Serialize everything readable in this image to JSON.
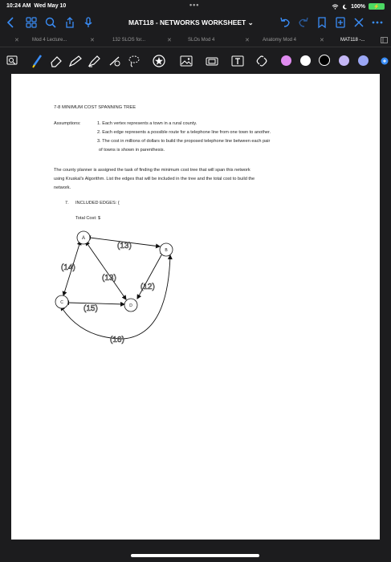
{
  "status": {
    "time": "10:24 AM",
    "date": "Wed May 10",
    "dots": "•••",
    "battery": "100%"
  },
  "nav": {
    "title": "MAT118 - NETWORKS WORKSHEET ⌄"
  },
  "tabs": [
    {
      "label": "Mod 4 Lecture..."
    },
    {
      "label": "132 SLOS for..."
    },
    {
      "label": "SLOs Mod 4"
    },
    {
      "label": "Anatomy Mod 4"
    },
    {
      "label": "MAT118 -..."
    }
  ],
  "colors": {
    "accent": "#3a8df7",
    "swatch_purple": "#e08cf0",
    "swatch_white": "#ffffff",
    "swatch_black": "#000000",
    "swatch_lavender": "#c4b7f5",
    "swatch_blue": "#9ba7f5"
  },
  "toolbar": {
    "tools": [
      "lasso-icon",
      "pen-icon",
      "eraser-icon",
      "pencil-icon",
      "highlighter-icon",
      "shapes-icon",
      "lasso-select-icon",
      "sticker-icon",
      "image-icon",
      "camera-icon",
      "text-icon",
      "link-icon"
    ]
  },
  "document": {
    "heading": "7-8  MINIMUM COST SPANNING TREE",
    "assumptions_label": "Assumptions:",
    "assumptions": [
      "1. Each vertex represents a town in a rural county.",
      "2. Each edge represents a possible route for a telephone line from one town to another.",
      "3. The cost in millions of dollars to build the proposed telephone line between each pair",
      "of towns is shown in parenthesis."
    ],
    "paragraph": [
      "The county planner is assigned the task of finding the minimum cost tree that will span this network",
      "using Kruskal's Algorithm.  List the edges that will be included in the tree and the total cost to build the",
      "network."
    ],
    "question_num": "7.",
    "question_text": "INCLUDED EDGES: {",
    "total_cost": "Total Cost: $"
  },
  "graph": {
    "vertices": [
      {
        "label": "A"
      },
      {
        "label": "B"
      },
      {
        "label": "C"
      },
      {
        "label": "D"
      }
    ],
    "edge_labels": [
      "(13)",
      "(14)",
      "(13)",
      "(12)",
      "(15)",
      "(16)"
    ]
  }
}
